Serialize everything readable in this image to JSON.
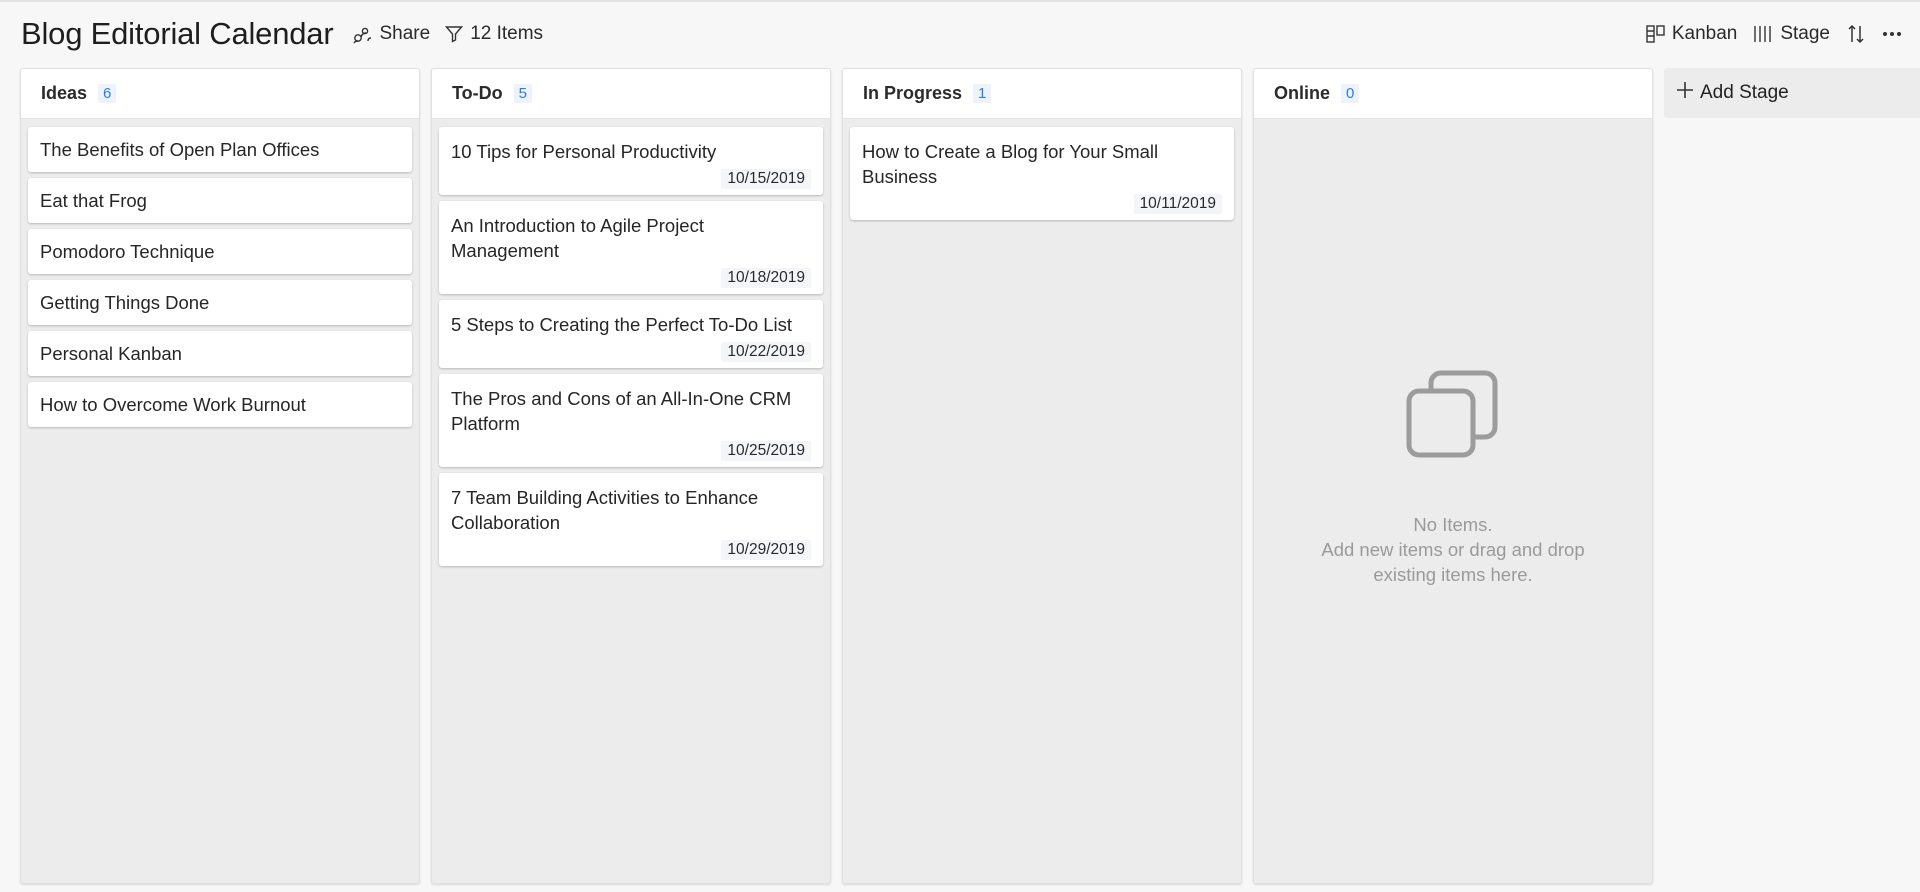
{
  "header": {
    "title": "Blog Editorial Calendar",
    "share_label": "Share",
    "filter_label": "12 Items",
    "view_label": "Kanban",
    "group_label": "Stage"
  },
  "columns": [
    {
      "title": "Ideas",
      "count": "6",
      "cards": [
        {
          "title": "The Benefits of Open Plan Offices"
        },
        {
          "title": "Eat that Frog"
        },
        {
          "title": "Pomodoro Technique"
        },
        {
          "title": "Getting Things Done"
        },
        {
          "title": "Personal Kanban"
        },
        {
          "title": "How to Overcome Work Burnout"
        }
      ]
    },
    {
      "title": "To-Do",
      "count": "5",
      "cards": [
        {
          "title": "10 Tips for Personal Productivity",
          "date": "10/15/2019"
        },
        {
          "title": "An Introduction to Agile Project Management",
          "date": "10/18/2019"
        },
        {
          "title": "5 Steps to Creating the Perfect To-Do List",
          "date": "10/22/2019"
        },
        {
          "title": "The Pros and Cons of an All-In-One CRM Platform",
          "date": "10/25/2019"
        },
        {
          "title": "7 Team Building Activities to Enhance Collaboration",
          "date": "10/29/2019"
        }
      ]
    },
    {
      "title": "In Progress",
      "count": "1",
      "cards": [
        {
          "title": "How to Create a Blog for Your Small Business",
          "date": "10/11/2019"
        }
      ]
    },
    {
      "title": "Online",
      "count": "0",
      "empty_line1": "No Items.",
      "empty_line2": "Add new items or drag and drop existing items here."
    }
  ],
  "add_stage_label": "Add Stage",
  "colors": {
    "accent": "#2f7be5",
    "column_bg": "#ececec",
    "empty_text": "#9a9a9a"
  }
}
